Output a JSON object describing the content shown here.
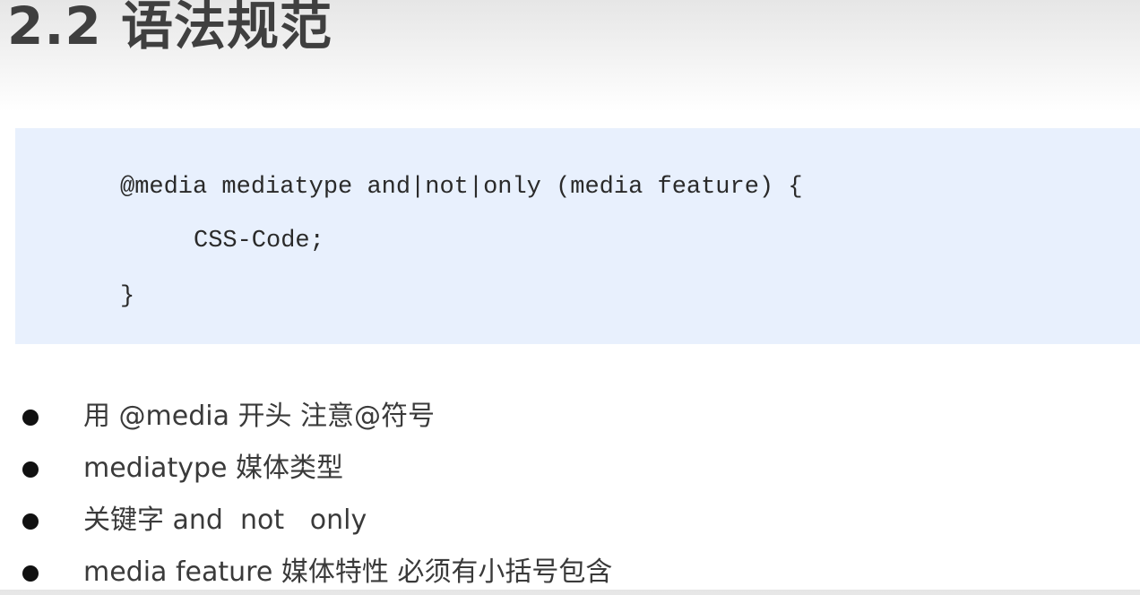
{
  "slide": {
    "title": "2.2 语法规范"
  },
  "code": {
    "lines": [
      "@media mediatype and|not|only (media feature) {",
      "CSS-Code;",
      "}"
    ]
  },
  "bullets": [
    "用 @media 开头 注意@符号",
    "mediatype 媒体类型",
    "关键字 and  not   only",
    "media feature 媒体特性 必须有小括号包含"
  ],
  "colors": {
    "code_background": "#e8f0fd",
    "title_text": "#3f3f3f",
    "bullet_dot": "#111111"
  }
}
